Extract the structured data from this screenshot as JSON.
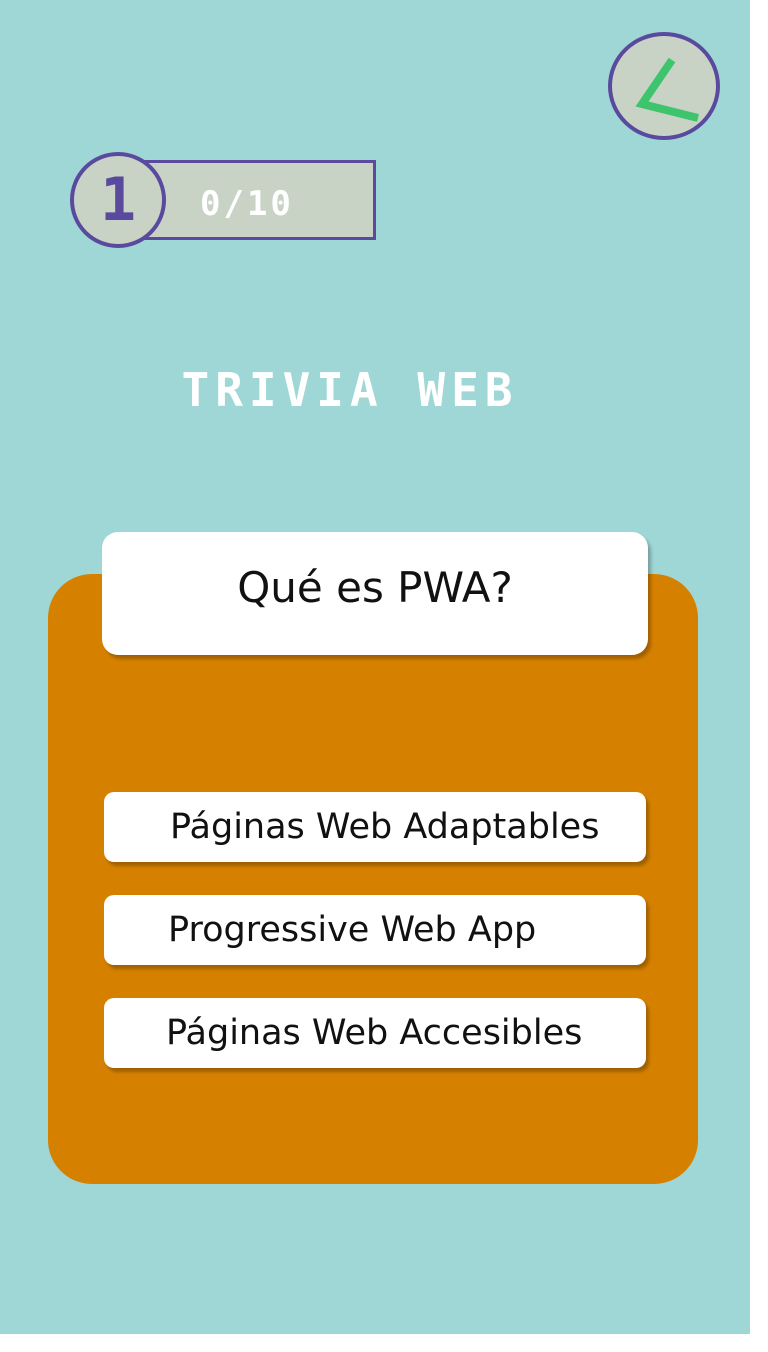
{
  "header": {
    "level": "1",
    "progress": "0/10",
    "timer_icon": "clock-hand-icon"
  },
  "title": "TRIVIA WEB",
  "question": {
    "text": "Qué es PWA?"
  },
  "answers": [
    {
      "label": "Páginas Web Adaptables"
    },
    {
      "label": "Progressive Web App"
    },
    {
      "label": "Páginas Web Accesibles"
    }
  ],
  "colors": {
    "background": "#9fd6d6",
    "card": "#d68000",
    "accent": "#5a4a9e",
    "badge_fill": "#c8d3c6",
    "timer_hand": "#3ec46d"
  }
}
